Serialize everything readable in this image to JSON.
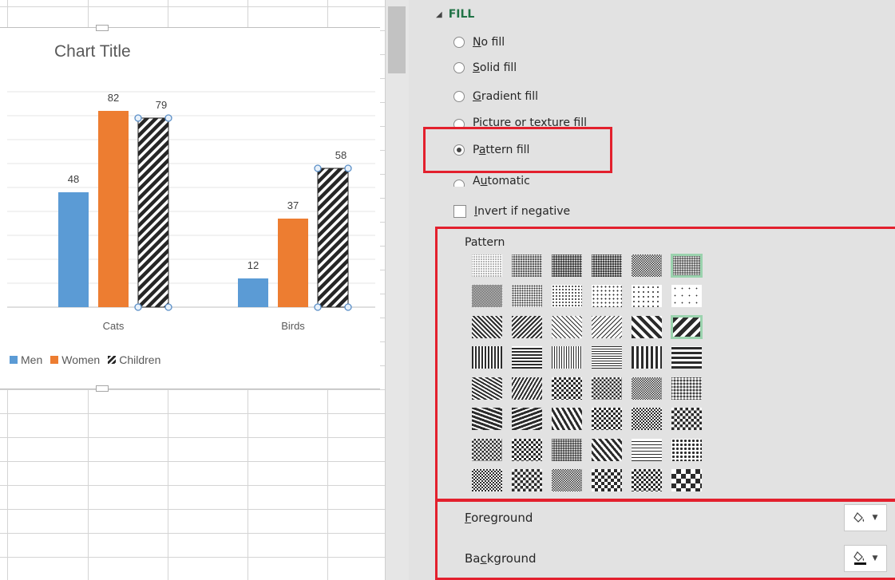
{
  "chart": {
    "title": "Chart Title"
  },
  "chart_data": {
    "type": "bar",
    "title": "Chart Title",
    "categories": [
      "Cats",
      "Birds"
    ],
    "series": [
      {
        "name": "Men",
        "values": [
          48,
          12
        ],
        "color": "#5b9bd5"
      },
      {
        "name": "Women",
        "values": [
          82,
          37
        ],
        "color": "#ed7d31"
      },
      {
        "name": "Children",
        "values": [
          79,
          58
        ],
        "color": "#262626",
        "pattern": "wide-upward-diagonal"
      }
    ],
    "ylim": [
      0,
      90
    ],
    "grid": true,
    "legend": "bottom-left",
    "data_labels": true
  },
  "pane": {
    "section_title": "FILL",
    "options": {
      "no_fill": {
        "pre": "",
        "key": "N",
        "post": "o fill"
      },
      "solid_fill": {
        "pre": "",
        "key": "S",
        "post": "olid fill"
      },
      "gradient_fill": {
        "pre": "",
        "key": "G",
        "post": "radient fill"
      },
      "picture_fill": {
        "pre": "",
        "key": "P",
        "post": "icture or texture fill"
      },
      "pattern_fill": {
        "pre": "P",
        "key": "a",
        "post": "ttern fill"
      },
      "automatic": {
        "pre": "A",
        "key": "u",
        "post": "tomatic"
      }
    },
    "selected_option": "Pattern fill",
    "invert": {
      "pre": "",
      "key": "I",
      "post": "nvert if negative"
    },
    "pattern_label": "Pattern",
    "selected_pattern": "wide-upward-diagonal",
    "foreground": {
      "pre": "",
      "key": "F",
      "post": "oreground"
    },
    "background": {
      "pre": "Ba",
      "key": "c",
      "post": "kground"
    },
    "icons": {
      "fill_color": "paint-bucket-icon",
      "dropdown": "chevron-down-icon"
    },
    "colors": {
      "accent_green": "#217346",
      "highlight_red": "#e3202d",
      "pattern_selection": "#9bd3ae"
    }
  }
}
